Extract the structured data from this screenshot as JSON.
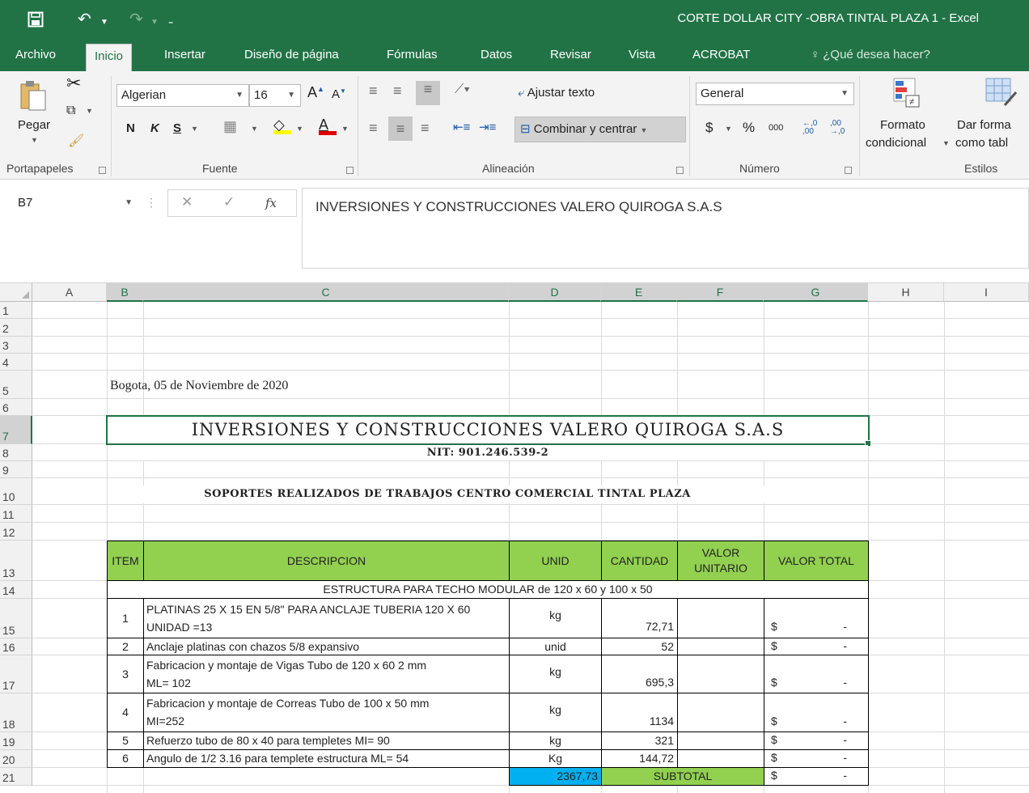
{
  "window": {
    "title": "CORTE DOLLAR CITY -OBRA TINTAL PLAZA 1 - Excel"
  },
  "ribbon_tabs": [
    {
      "label": "Archivo"
    },
    {
      "label": "Inicio"
    },
    {
      "label": "Insertar"
    },
    {
      "label": "Diseño de página"
    },
    {
      "label": "Fórmulas"
    },
    {
      "label": "Datos"
    },
    {
      "label": "Revisar"
    },
    {
      "label": "Vista"
    },
    {
      "label": "ACROBAT"
    }
  ],
  "tell_me": "¿Qué desea hacer?",
  "ribbon": {
    "clipboard": {
      "paste": "Pegar",
      "group": "Portapapeles"
    },
    "font": {
      "name": "Algerian",
      "size": "16",
      "bold": "N",
      "italic": "K",
      "underline": "S",
      "group": "Fuente"
    },
    "alignment": {
      "wrap": "Ajustar texto",
      "merge": "Combinar y centrar",
      "group": "Alineación"
    },
    "number": {
      "format": "General",
      "currency": "$",
      "percent": "%",
      "thousands": "000",
      "inc_decimal": "←,0 ,00",
      "dec_decimal": ",00 →,0",
      "group": "Número"
    },
    "styles": {
      "cond_line1": "Formato",
      "cond_line2": "condicional",
      "table_line1": "Dar forma",
      "table_line2": "como tabl",
      "group": "Estilos"
    }
  },
  "formula_bar": {
    "name_box": "B7",
    "fx": "fx",
    "content": "INVERSIONES Y CONSTRUCCIONES VALERO QUIROGA S.A.S"
  },
  "columns": [
    "A",
    "B",
    "C",
    "D",
    "E",
    "F",
    "G",
    "H",
    "I"
  ],
  "rows": [
    "1",
    "2",
    "3",
    "4",
    "5",
    "6",
    "7",
    "8",
    "9",
    "10",
    "11",
    "12",
    "13",
    "14",
    "15",
    "16",
    "17",
    "18",
    "19",
    "20",
    "21"
  ],
  "sheet": {
    "date_line": "Bogota, 05 de Noviembre  de 2020",
    "company": "INVERSIONES Y CONSTRUCCIONES VALERO QUIROGA S.A.S",
    "nit": "NIT: 901.246.539-2",
    "subject": "SOPORTES REALIZADOS DE TRABAJOS  CENTRO COMERCIAL TINTAL PLAZA",
    "headers": {
      "item": "ITEM",
      "description": "DESCRIPCION",
      "unit": "UNID",
      "quantity": "CANTIDAD",
      "unit_value_1": "VALOR",
      "unit_value_2": "UNITARIO",
      "total_value": "VALOR TOTAL"
    },
    "section": "ESTRUCTURA PARA TECHO MODULAR de 120 x 60 y 100 x 50",
    "items": [
      {
        "item": "1",
        "desc1": "PLATINAS 25 X 15 EN 5/8\" PARA ANCLAJE  TUBERIA 120 X 60",
        "desc2": "UNIDAD =13",
        "unit": "kg",
        "qty": "72,71",
        "cur": "$",
        "total": "-"
      },
      {
        "item": "2",
        "desc1": "Anclaje platinas con chazos 5/8 expansivo",
        "desc2": "",
        "unit": "unid",
        "qty": "52",
        "cur": "$",
        "total": "-"
      },
      {
        "item": "3",
        "desc1": "Fabricacion y montaje  de Vigas Tubo de 120 x 60  2 mm",
        "desc2": "ML= 102",
        "unit": "kg",
        "qty": "695,3",
        "cur": "$",
        "total": "-"
      },
      {
        "item": "4",
        "desc1": "Fabricacion y montaje  de Correas Tubo de 100 x 50 mm",
        "desc2": "MI=252",
        "unit": "kg",
        "qty": "1134",
        "cur": "$",
        "total": "-"
      },
      {
        "item": "5",
        "desc1": "Refuerzo tubo de 80 x 40 para templetes MI= 90",
        "desc2": "",
        "unit": "kg",
        "qty": "321",
        "cur": "$",
        "total": "-"
      },
      {
        "item": "6",
        "desc1": "Angulo de 1/2 3.16 para templete estructura ML= 54",
        "desc2": "",
        "unit": "Kg",
        "qty": "144,72",
        "cur": "$",
        "total": "-"
      }
    ],
    "sum_qty": "2367,73",
    "subtotal_label": "SUBTOTAL",
    "subtotal_cur": "$",
    "subtotal_value": "-"
  },
  "colors": {
    "excel_green": "#217346",
    "header_fill": "#92d050",
    "sum_fill": "#00b0f0"
  }
}
